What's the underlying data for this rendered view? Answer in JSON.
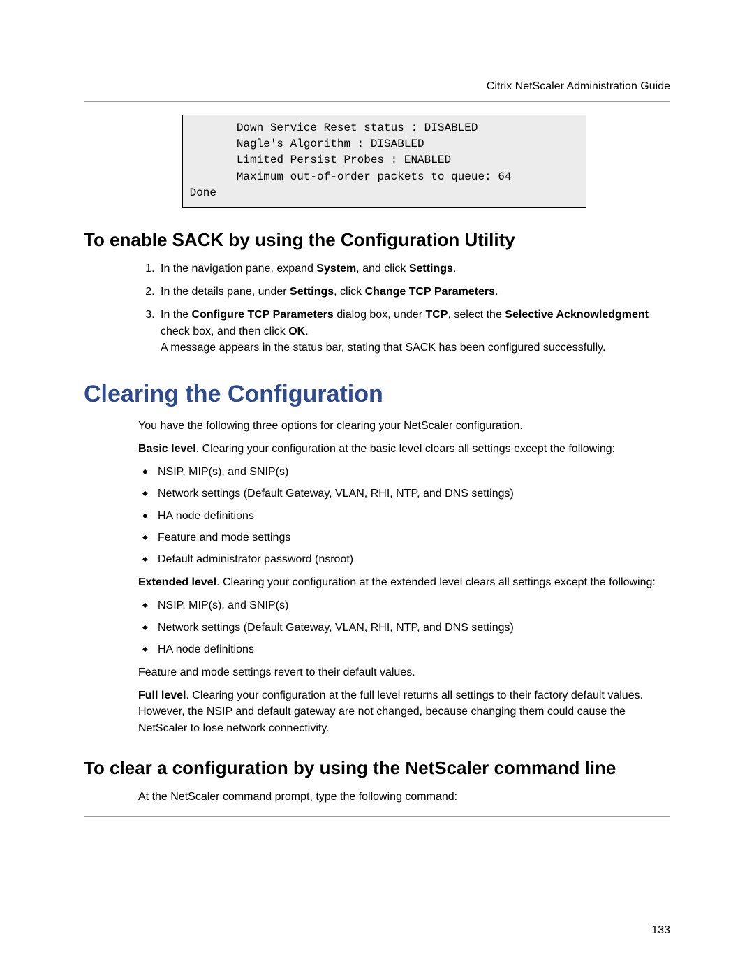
{
  "header": "Citrix NetScaler Administration Guide",
  "code_block": "        Down Service Reset status : DISABLED\n        Nagle's Algorithm : DISABLED\n        Limited Persist Probes : ENABLED\n        Maximum out-of-order packets to queue: 64\n Done",
  "section1": {
    "title": "To enable SACK by using the Configuration Utility",
    "steps": {
      "s1_a": "In the navigation pane, expand ",
      "s1_b1": "System",
      "s1_c": ", and click ",
      "s1_b2": "Settings",
      "s1_d": ".",
      "s2_a": "In the details pane, under ",
      "s2_b1": "Settings",
      "s2_c": ", click ",
      "s2_b2": "Change TCP Parameters",
      "s2_d": ".",
      "s3_a": "In the ",
      "s3_b1": "Configure TCP Parameters",
      "s3_c": " dialog box, under ",
      "s3_b2": "TCP",
      "s3_d": ", select the ",
      "s3_b3": "Selective Acknowledgment",
      "s3_e": " check box, and then click ",
      "s3_b4": "OK",
      "s3_f": ".",
      "s3_msg": "A message appears in the status bar, stating that SACK has been configured successfully."
    }
  },
  "section2": {
    "title": "Clearing the Configuration",
    "intro": "You have the following three options for clearing your NetScaler configuration.",
    "basic_label": "Basic level",
    "basic_text": ". Clearing your configuration at the basic level clears all settings except the following:",
    "basic_bullets": [
      "NSIP, MIP(s), and SNIP(s)",
      "Network settings (Default Gateway, VLAN, RHI, NTP, and DNS settings)",
      "HA node definitions",
      "Feature and mode settings",
      "Default administrator password (nsroot)"
    ],
    "extended_label": "Extended level",
    "extended_text": ". Clearing your configuration at the extended level clears all settings except the following:",
    "extended_bullets": [
      "NSIP, MIP(s), and SNIP(s)",
      "Network settings (Default Gateway, VLAN, RHI, NTP, and DNS settings)",
      "HA node definitions"
    ],
    "extended_note": "Feature and mode settings revert to their default values.",
    "full_label": "Full level",
    "full_text": ". Clearing your configuration at the full level returns all settings to their factory default values. However, the NSIP and default gateway are not changed, because changing them could cause the NetScaler to lose network connectivity."
  },
  "section3": {
    "title": "To clear a configuration by using the NetScaler command line",
    "text": "At the NetScaler command prompt, type the following command:"
  },
  "page_number": "133"
}
